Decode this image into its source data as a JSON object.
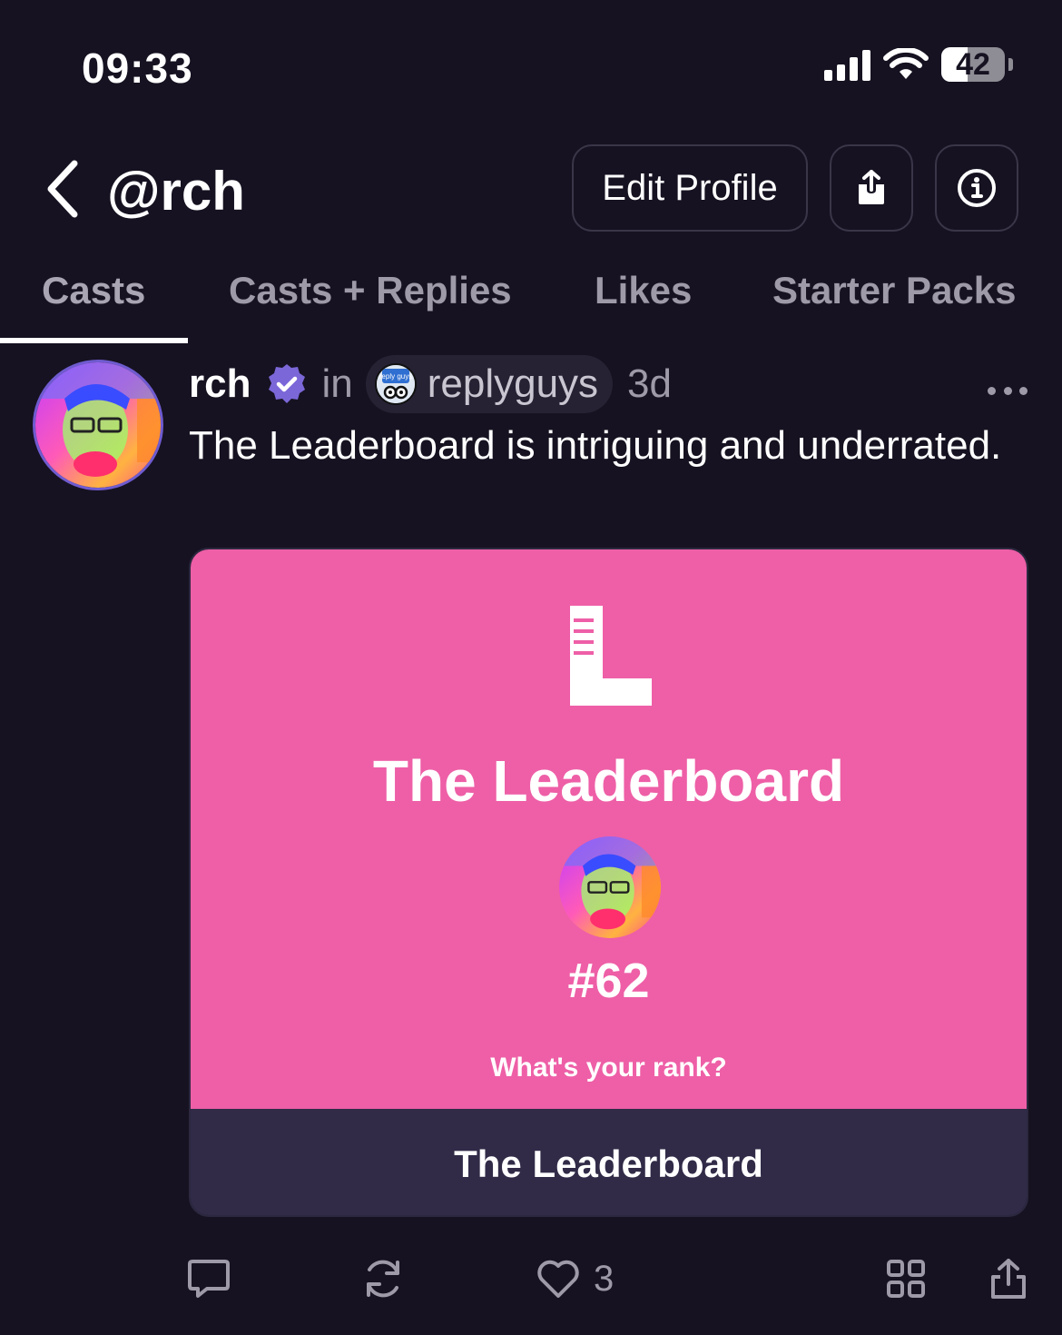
{
  "status_bar": {
    "time": "09:33",
    "battery": "42"
  },
  "header": {
    "handle": "@rch",
    "edit_profile_label": "Edit Profile"
  },
  "tabs": [
    {
      "label": "Casts",
      "active": true
    },
    {
      "label": "Casts + Replies",
      "active": false
    },
    {
      "label": "Likes",
      "active": false
    },
    {
      "label": "Starter Packs",
      "active": false
    }
  ],
  "cast": {
    "author": "rch",
    "in_label": "in",
    "channel": "replyguys",
    "channel_icon_text": "reply guys",
    "time_ago": "3d",
    "text": "The Leaderboard is intriguing and underrated.",
    "frame": {
      "title": "The Leaderboard",
      "rank": "#62",
      "question": "What's your rank?",
      "button_label": "The Leaderboard",
      "background_color": "#ee5fa7",
      "button_color": "#312b48"
    },
    "likes": "3"
  },
  "colors": {
    "background": "#161221",
    "muted_text": "#9e9aa8",
    "verified_badge": "#7c67d8"
  }
}
